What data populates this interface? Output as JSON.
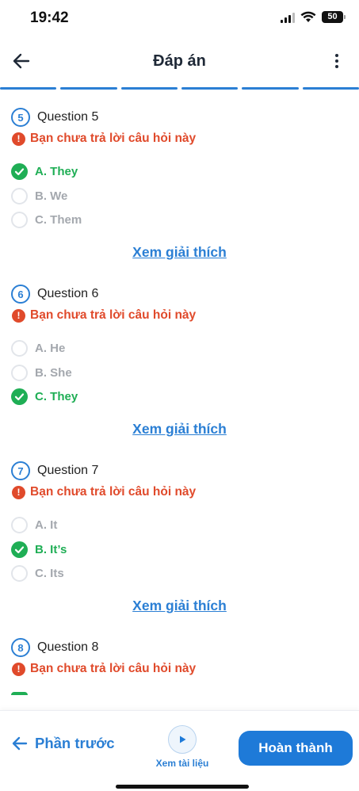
{
  "status_bar": {
    "time": "19:42",
    "battery": "50"
  },
  "header": {
    "title": "Đáp án"
  },
  "progress_segments": 6,
  "questions": [
    {
      "number": "5",
      "title": "Question 5",
      "warning": "Bạn chưa trả lời câu hỏi này",
      "options": [
        {
          "label": "A. They",
          "correct": true
        },
        {
          "label": "B. We",
          "correct": false
        },
        {
          "label": "C. Them",
          "correct": false
        }
      ],
      "explain": "Xem giải thích"
    },
    {
      "number": "6",
      "title": "Question 6",
      "warning": "Bạn chưa trả lời câu hỏi này",
      "options": [
        {
          "label": "A. He",
          "correct": false
        },
        {
          "label": "B. She",
          "correct": false
        },
        {
          "label": "C. They",
          "correct": true
        }
      ],
      "explain": "Xem giải thích"
    },
    {
      "number": "7",
      "title": "Question 7",
      "warning": "Bạn chưa trả lời câu hỏi này",
      "options": [
        {
          "label": "A. It",
          "correct": false
        },
        {
          "label": "B. It’s",
          "correct": true
        },
        {
          "label": "C. Its",
          "correct": false
        }
      ],
      "explain": "Xem giải thích"
    },
    {
      "number": "8",
      "title": "Question 8",
      "warning": "Bạn chưa trả lời câu hỏi này"
    }
  ],
  "bottom_bar": {
    "prev_label": "Phần trước",
    "doc_label": "Xem tài liệu",
    "finish_label": "Hoàn thành"
  },
  "colors": {
    "accent": "#1e7ad8",
    "correct": "#1fae55",
    "warning": "#e04a2b",
    "muted": "#a4a8ae"
  }
}
